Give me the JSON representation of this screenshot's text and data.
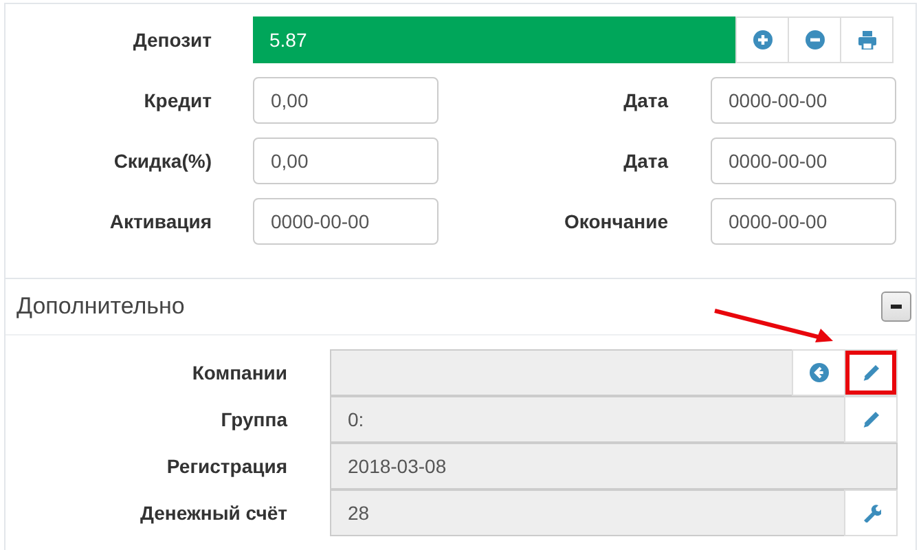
{
  "deposit": {
    "label": "Депозит",
    "value": "5.87",
    "buttons": [
      {
        "kind": "plus",
        "highlighted": false
      },
      {
        "kind": "minus",
        "highlighted": false
      },
      {
        "kind": "print",
        "highlighted": false
      }
    ]
  },
  "rows": [
    {
      "left": {
        "label": "Кредит",
        "value": "0,00"
      },
      "right": {
        "label": "Дата",
        "value": "0000-00-00"
      }
    },
    {
      "left": {
        "label": "Скидка(%)",
        "value": "0,00"
      },
      "right": {
        "label": "Дата",
        "value": "0000-00-00"
      }
    },
    {
      "left": {
        "label": "Активация",
        "value": "0000-00-00"
      },
      "right": {
        "label": "Окончание",
        "value": "0000-00-00"
      }
    }
  ],
  "section": {
    "title": "Дополнительно",
    "expanded": true,
    "fields": [
      {
        "label": "Компании",
        "disabled": true,
        "buttons": [
          {
            "kind": "back",
            "highlighted": false
          },
          {
            "kind": "pencil",
            "highlighted": true
          }
        ]
      },
      {
        "label": "Группа",
        "value": "0:",
        "disabled": true,
        "buttons": [
          {
            "kind": "pencil",
            "highlighted": false
          }
        ]
      },
      {
        "label": "Регистрация",
        "value": "2018-03-08",
        "disabled": true
      },
      {
        "label": "Денежный счёт",
        "value": "28",
        "disabled": true,
        "buttons": [
          {
            "kind": "wrench",
            "highlighted": false
          }
        ]
      }
    ]
  }
}
